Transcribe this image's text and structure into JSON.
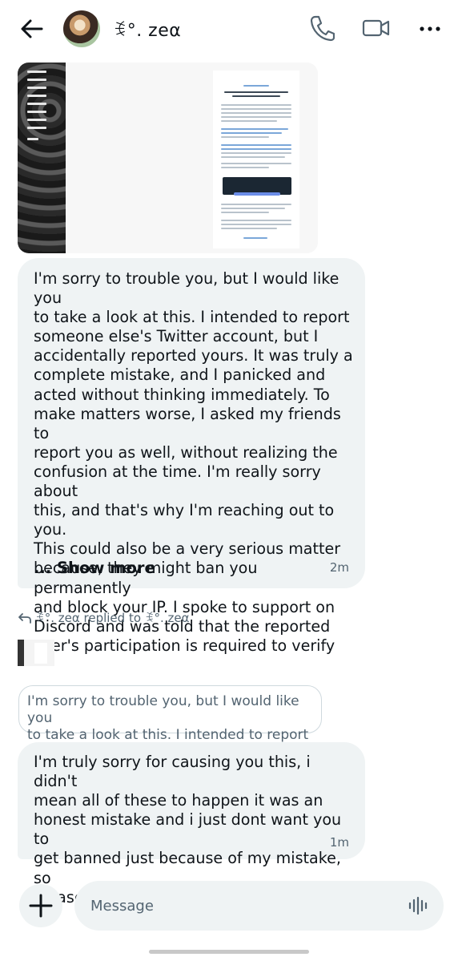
{
  "header": {
    "contact_name": "ꉂ°. zeα",
    "back_icon": "arrow-left-icon",
    "call_icon": "phone-icon",
    "video_icon": "video-camera-icon",
    "more_icon": "more-horizontal-icon"
  },
  "messages": [
    {
      "text": "I'm sorry to trouble you, but I would like you\nto take a look at this. I intended to report\nsomeone else's Twitter account, but I\naccidentally reported yours. It was truly a\ncomplete mistake, and I panicked and\nacted without thinking immediately. To\nmake matters worse, I asked my friends to\nreport you as well, without realizing the\nconfusion at the time. I'm really sorry about\nthis, and that's why I'm reaching out to you.\nThis could also be a very serious matter\nbecause, they might ban you permanently\nand block your IP. I spoke to support on\nDiscord and was told that the reported\nuser's participation is required to verify",
      "show_more": "... Show more",
      "time": "2m"
    },
    {
      "reply_label": "ꉂ°. zeα replied to ꉂ°. zeα",
      "quoted_text": "I'm sorry to trouble you, but I would like you\nto take a look at this. I intended to report s...",
      "text": "I'm truly sorry for causing you this, i didn't\nmean all of these to happen it was an\nhonest mistake and i just dont want you to\nget banned just because of my mistake, so\nplease take it seriously. 😢",
      "time": "1m"
    }
  ],
  "composer": {
    "placeholder": "Message",
    "add_icon": "plus-icon",
    "voice_icon": "voice-waveform-icon"
  },
  "colors": {
    "bubble_bg": "#eff3f4",
    "muted_text": "#536471",
    "text": "#0f1419"
  }
}
